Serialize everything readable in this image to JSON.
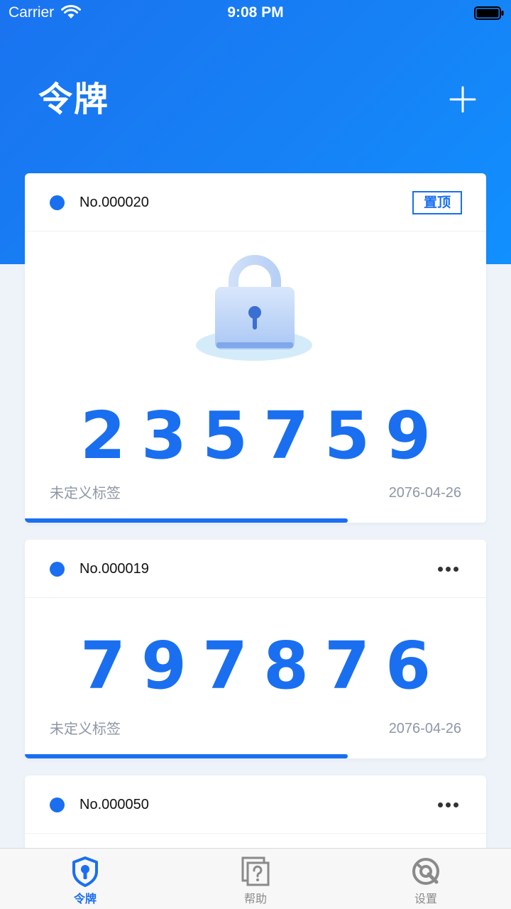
{
  "status_bar": {
    "carrier": "Carrier",
    "time": "9:08 PM"
  },
  "header": {
    "title": "令牌",
    "add_icon": "plus-icon"
  },
  "colors": {
    "primary": "#1a6ff0",
    "muted_text": "#8e96a6",
    "page_bg": "#eef2f9"
  },
  "cards": [
    {
      "number": "No.000020",
      "action_label": "置顶",
      "code": "235759",
      "tag": "未定义标签",
      "date": "2076-04-26",
      "progress": 0.7,
      "icon": "lock-icon"
    },
    {
      "number": "No.000019",
      "action_icon": "more-icon",
      "code": "797876",
      "tag": "未定义标签",
      "date": "2076-04-26",
      "progress": 0.7
    },
    {
      "number": "No.000050",
      "action_icon": "more-icon"
    }
  ],
  "tabs": [
    {
      "label": "令牌",
      "icon": "shield-key-icon",
      "active": true,
      "color": "#1a6ff0"
    },
    {
      "label": "帮助",
      "icon": "help-icon",
      "active": false,
      "color": "#8a8a8a"
    },
    {
      "label": "设置",
      "icon": "settings-icon",
      "active": false,
      "color": "#8a8a8a"
    }
  ]
}
